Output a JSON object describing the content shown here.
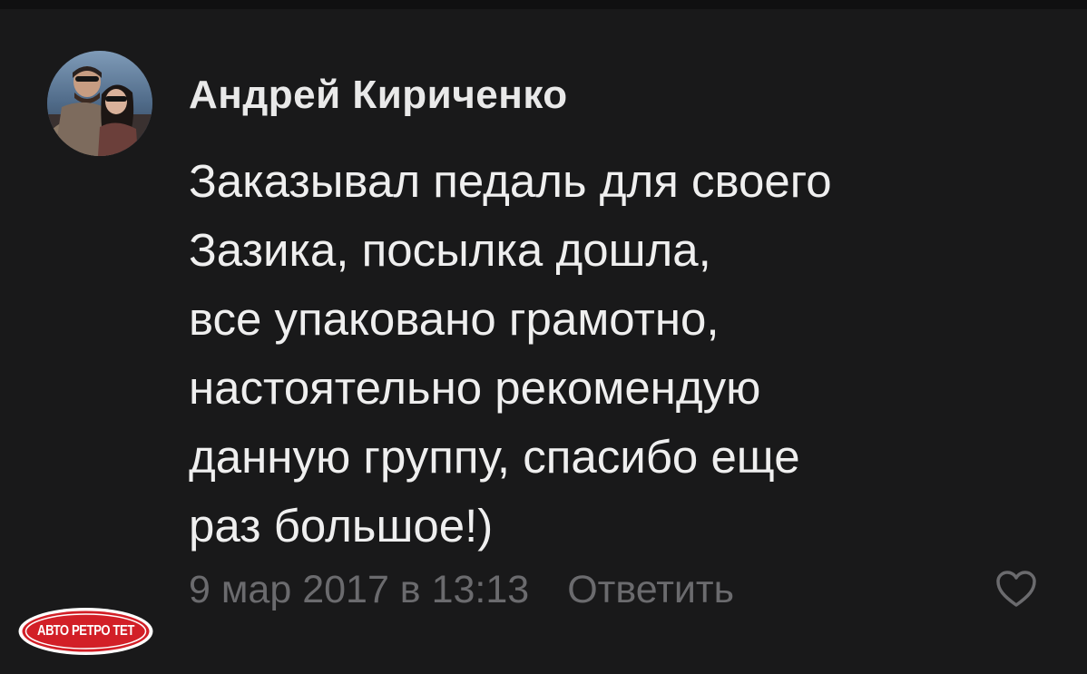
{
  "comment": {
    "author": "Андрей Кириченко",
    "lines": [
      "Заказывал педаль для своего",
      "Зазика, посылка дошла,",
      "все упаковано грамотно,",
      "настоятельно рекомендую",
      "данную группу, спасибо еще",
      "раз большое!)"
    ],
    "date": "9 мар 2017 в 13:13",
    "reply_label": "Ответить",
    "icons": {
      "like": "heart-outline-icon"
    }
  },
  "watermark": {
    "text": "АВТО РЕТРО ТЕТ"
  },
  "colors": {
    "background": "#19191a",
    "text": "#efefef",
    "muted": "#6b6b6e",
    "watermark_red": "#d21f27"
  }
}
